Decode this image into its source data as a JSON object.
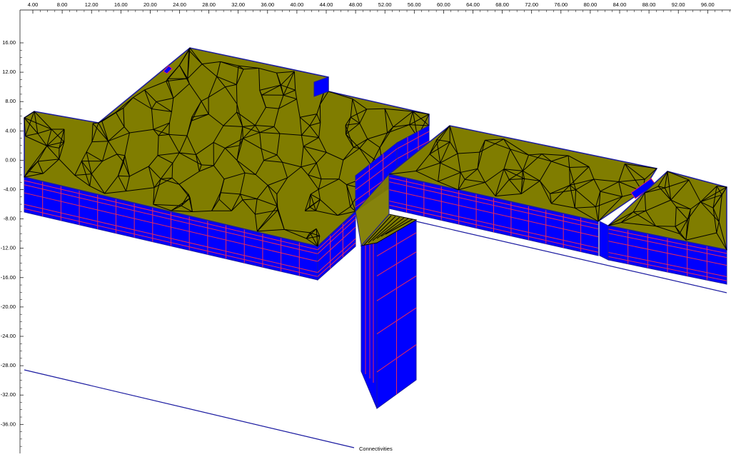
{
  "rulers": {
    "top": [
      "4.00",
      "8.00",
      "12.00",
      "16.00",
      "20.00",
      "24.00",
      "28.00",
      "32.00",
      "36.00",
      "40.00",
      "44.00",
      "48.00",
      "52.00",
      "56.00",
      "60.00",
      "64.00",
      "68.00",
      "72.00",
      "76.00",
      "80.00",
      "84.00",
      "88.00",
      "92.00",
      "96.00"
    ],
    "left": [
      "16.00",
      "12.00",
      "8.00",
      "4.00",
      "0.00",
      "-4.00",
      "-8.00",
      "-12.00",
      "-16.00",
      "-20.00",
      "-24.00",
      "-28.00",
      "-32.00",
      "-36.00"
    ]
  },
  "caption": "Connectivities",
  "colors": {
    "top_face": "#807d00",
    "side_face": "#0000ff",
    "grid_line": "#e8295a",
    "edge": "#000000",
    "outline": "#1a1aa0"
  }
}
